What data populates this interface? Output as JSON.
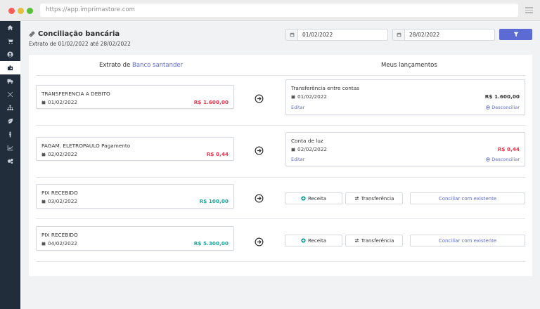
{
  "browser": {
    "url": "https://app.imprimastore.com"
  },
  "sidebar": {
    "items": [
      {
        "icon": "home-icon"
      },
      {
        "icon": "cart-icon"
      },
      {
        "icon": "user-circle-icon"
      },
      {
        "icon": "bank-icon",
        "active": true
      },
      {
        "icon": "truck-icon"
      },
      {
        "icon": "tools-icon"
      },
      {
        "icon": "sitemap-icon"
      },
      {
        "icon": "leaf-icon"
      },
      {
        "icon": "person-icon"
      },
      {
        "icon": "chart-icon"
      },
      {
        "icon": "gears-icon"
      }
    ]
  },
  "header": {
    "title": "Conciliação bancária",
    "subtitle": "Extrato de 01/02/2022 até 28/02/2022",
    "date_from": "01/02/2022",
    "date_to": "28/02/2022"
  },
  "columns": {
    "statement_prefix": "Extrato de",
    "bank_name": "Banco santander",
    "entries": "Meus lançamentos"
  },
  "rows": [
    {
      "statement": {
        "desc": "TRANSFERENCIA A DEBITO",
        "date": "01/02/2022",
        "amount": "R$ 1.600,00",
        "sign": "neg"
      },
      "entry": {
        "desc": "Transferência entre contas",
        "date": "01/02/2022",
        "amount": "R$ 1.600,00",
        "sign": "dark",
        "edit": "Editar",
        "unlink": "Desconciliar"
      }
    },
    {
      "statement": {
        "desc": "PAGAM. ELETROPAULO Pagamento",
        "date": "02/02/2022",
        "amount": "R$ 0,44",
        "sign": "neg"
      },
      "entry": {
        "desc": "Conta de luz",
        "date": "02/02/2022",
        "amount": "R$ 0,44",
        "sign": "neg",
        "edit": "Editar",
        "unlink": "Desconciliar"
      }
    },
    {
      "statement": {
        "desc": "PIX RECEBIDO",
        "date": "03/02/2022",
        "amount": "R$ 100,00",
        "sign": "pos"
      },
      "actions": {
        "income": "Receita",
        "transfer": "Transferência",
        "existing": "Conciliar com existente"
      }
    },
    {
      "statement": {
        "desc": "PIX RECEBIDO",
        "date": "04/02/2022",
        "amount": "R$ 5.300,00",
        "sign": "pos"
      },
      "actions": {
        "income": "Receita",
        "transfer": "Transferência",
        "existing": "Conciliar com existente"
      }
    }
  ],
  "colors": {
    "accent": "#5c6bd3",
    "negative": "#e8334a",
    "positive": "#17a89a",
    "sidebar": "#212d3b"
  }
}
